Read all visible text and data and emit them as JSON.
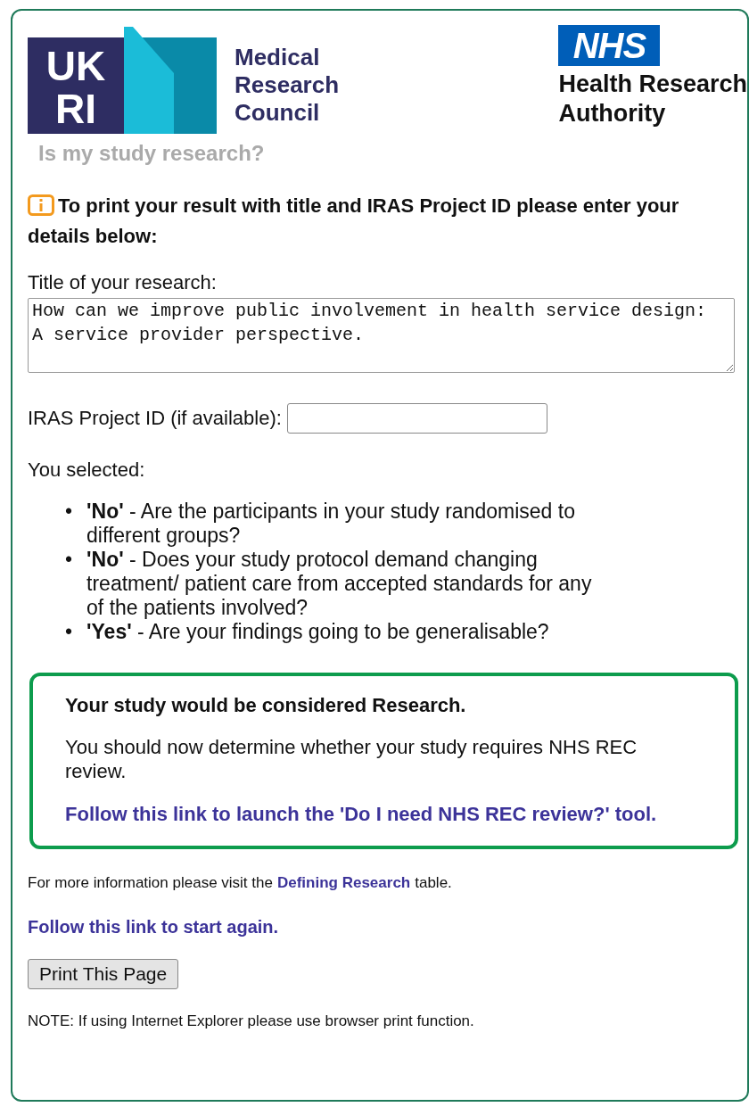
{
  "logos": {
    "ukri": {
      "mark_top": "UK",
      "mark_bottom": "RI",
      "name_lines": [
        "Medical",
        "Research",
        "Council"
      ]
    },
    "nhs": {
      "mark": "NHS",
      "name_lines": [
        "Health Research",
        "Authority"
      ]
    }
  },
  "tool_title": "Is my study research?",
  "print_intro": "To print your result with title and IRAS Project ID please enter your details below:",
  "title_field": {
    "label": "Title of your research:",
    "value": "How can we improve public involvement in health service design:\nA service provider perspective."
  },
  "iras_field": {
    "label": "IRAS Project ID (if available):"
  },
  "selected_label": "You selected:",
  "answers": [
    {
      "marker": "•",
      "text": "**'No'** - Are the participants in your study randomised to different groups?"
    },
    {
      "marker": "•",
      "text": "**'No'** - Does your study protocol demand changing treatment/ patient care from accepted standards for any of the patients involved?"
    },
    {
      "marker": "•",
      "text": "**'Yes'** - Are your findings going to be generalisable?"
    }
  ],
  "result": {
    "heading": "Your study would be considered Research.",
    "body": "You should now determine whether your study requires NHS REC review.",
    "link": "Follow this link to launch the 'Do I need NHS REC review?' tool."
  },
  "more_info": {
    "before": "For more information please visit the",
    "link": "Defining Research",
    "after": "table."
  },
  "start_again_link": "Follow this link to start again.",
  "print_button": "Print This Page",
  "note": "NOTE: If using Internet Explorer please use browser print function."
}
